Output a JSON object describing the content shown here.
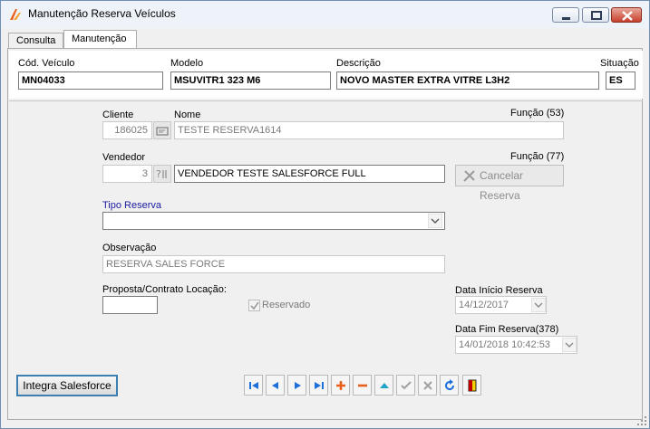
{
  "window": {
    "title": "Manutenção Reserva Veículos",
    "icon": "app-logo-icon"
  },
  "tabs": [
    {
      "label": "Consulta",
      "active": false
    },
    {
      "label": "Manutenção",
      "active": true
    }
  ],
  "vehicle": {
    "cod_label": "Cód. Veículo",
    "cod_value": "MN04033",
    "modelo_label": "Modelo",
    "modelo_value": "MSUVITR1 323 M6",
    "descricao_label": "Descrição",
    "descricao_value": "NOVO MASTER EXTRA VITRE L3H2",
    "situacao_label": "Situação",
    "situacao_value": "ES"
  },
  "form": {
    "cliente_label": "Cliente",
    "cliente_value": "186025",
    "nome_label": "Nome",
    "nome_value": "TESTE RESERVA1614",
    "funcao1_label": "Função (53)",
    "vendedor_label": "Vendedor",
    "vendedor_value": "3",
    "vendedor_nome_value": "VENDEDOR TESTE SALESFORCE FULL",
    "funcao2_label": "Função (77)",
    "cancelar_label": "Cancelar Reserva",
    "tipo_reserva_label": "Tipo Reserva",
    "tipo_reserva_value": "",
    "observacao_label": "Observação",
    "observacao_value": "RESERVA SALES FORCE",
    "proposta_label": "Proposta/Contrato Locação:",
    "proposta_value": "",
    "reservado_label": "Reservado",
    "reservado_checked": true,
    "data_inicio_label": "Data Início Reserva",
    "data_inicio_value": "14/12/2017",
    "data_fim_label": "Data Fim Reserva(378)",
    "data_fim_value": "14/01/2018 10:42:53"
  },
  "footer": {
    "integra_label": "Integra Salesforce"
  },
  "navigator": [
    {
      "name": "first-record-icon",
      "color": "#1e6fd9"
    },
    {
      "name": "prior-record-icon",
      "color": "#1e6fd9"
    },
    {
      "name": "next-record-icon",
      "color": "#1e6fd9"
    },
    {
      "name": "last-record-icon",
      "color": "#1e6fd9"
    },
    {
      "name": "insert-icon",
      "color": "#e8601c"
    },
    {
      "name": "delete-icon",
      "color": "#e8601c"
    },
    {
      "name": "edit-icon",
      "color": "#1fa3c9"
    },
    {
      "name": "post-icon",
      "color": "#a0a0a0"
    },
    {
      "name": "cancel-icon",
      "color": "#a0a0a0"
    },
    {
      "name": "refresh-icon",
      "color": "#1e6fd9"
    },
    {
      "name": "exit-door-icon",
      "color": "#c00000"
    }
  ]
}
